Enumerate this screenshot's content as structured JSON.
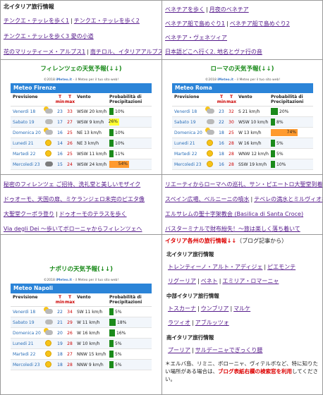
{
  "north_header": "北イタリア旅行情報",
  "north_links": [
    [
      "チンクエ・テッレを歩く1",
      "チンクエ・テッレを歩く2"
    ],
    [
      "チンクエ・テッレを歩く3 愛の小道"
    ],
    [
      "花のマリッティーメ・アルプス1",
      "南チロル、イタリアアルプスへ"
    ]
  ],
  "venice_links": [
    [
      "ベネチアを歩く",
      "月夜のベネチア"
    ],
    [
      "ベネチア船で島めぐり1",
      "ベネチア船で島めぐり2"
    ],
    [
      "ベネチア・ヴェネツィア"
    ],
    [
      "日本語どこへ行く2. 地名とヴァ行の音"
    ]
  ],
  "florence_title": "フィレンツェの天気予報(↓↓)",
  "rome_title": "ローマの天気予報(↓↓)",
  "naples_title": "ナポリの天気予報(↓↓)",
  "widget_credit_pre": "©2018",
  "widget_credit_brand": "iMeteo.it",
  "widget_credit_post": " - il Meteo per il tuo sito web!",
  "widget_cols": {
    "day": "Previsione",
    "tmin": "T min",
    "tmax": "T max",
    "wind": "Vento",
    "prob": "Probabilità di Precipitazioni"
  },
  "colors": {
    "bar_blue": "#2b84d8",
    "prob_green": "#1b8a1b",
    "prob_yellow": "#ffff33",
    "prob_orange": "#ff9a2e",
    "red_text": "#dd0000"
  },
  "widgets": [
    {
      "key": "florence",
      "name": "Meteo Firenze",
      "rows": [
        {
          "day": "Venerdi 18",
          "icon": "cloud-icon",
          "tmin": "23",
          "tmax": "33",
          "wind": "WSW 20 km/h",
          "prob": 10,
          "color": "green"
        },
        {
          "day": "Sabato 19",
          "icon": "cloud-icon",
          "tmin": "17",
          "tmax": "27",
          "wind": "WSW 9 km/h",
          "prob": 26,
          "color": "yellow"
        },
        {
          "day": "Domenica 20",
          "icon": "cloud-icon",
          "tmin": "16",
          "tmax": "25",
          "wind": "NE 13 km/h",
          "prob": 10,
          "color": "green"
        },
        {
          "day": "Lunedi 21",
          "icon": "sun-icon",
          "tmin": "14",
          "tmax": "26",
          "wind": "NE 3 km/h",
          "prob": 10,
          "color": "green"
        },
        {
          "day": "Martedi 22",
          "icon": "sun-icon",
          "tmin": "16",
          "tmax": "25",
          "wind": "WSW 11 km/h",
          "prob": 11,
          "color": "green"
        },
        {
          "day": "Mercoledi 23",
          "icon": "storm-icon",
          "tmin": "15",
          "tmax": "24",
          "wind": "WSW 24 km/h",
          "prob": 54,
          "color": "orange"
        }
      ]
    },
    {
      "key": "rome",
      "name": "Meteo Roma",
      "rows": [
        {
          "day": "Venerdi 18",
          "icon": "cloud-icon",
          "tmin": "23",
          "tmax": "32",
          "wind": "S 21 km/h",
          "prob": 20,
          "color": "green"
        },
        {
          "day": "Sabato 19",
          "icon": "cloud-icon",
          "tmin": "22",
          "tmax": "30",
          "wind": "WSW 10 km/h",
          "prob": 8,
          "color": "green"
        },
        {
          "day": "Domenica 20",
          "icon": "cloud-icon",
          "tmin": "18",
          "tmax": "25",
          "wind": "W 13 km/h",
          "prob": 74,
          "color": "orange"
        },
        {
          "day": "Lunedi 21",
          "icon": "sun-icon",
          "tmin": "16",
          "tmax": "28",
          "wind": "W 16 km/h",
          "prob": 5,
          "color": "green"
        },
        {
          "day": "Martedi 22",
          "icon": "sun-icon",
          "tmin": "18",
          "tmax": "28",
          "wind": "WNW 12 km/h",
          "prob": 5,
          "color": "green"
        },
        {
          "day": "Mercoledi 23",
          "icon": "sun-icon",
          "tmin": "16",
          "tmax": "28",
          "wind": "SSW 19 km/h",
          "prob": 10,
          "color": "green"
        }
      ]
    },
    {
      "key": "naples",
      "name": "Meteo Napoli",
      "rows": [
        {
          "day": "Venerdi 18",
          "icon": "cloud-icon",
          "tmin": "22",
          "tmax": "34",
          "wind": "SW 11 km/h",
          "prob": 5,
          "color": "green"
        },
        {
          "day": "Sabato 19",
          "icon": "cloud-icon",
          "tmin": "21",
          "tmax": "29",
          "wind": "W 11 km/h",
          "prob": 18,
          "color": "green"
        },
        {
          "day": "Domenica 20",
          "icon": "cloud-icon",
          "tmin": "20",
          "tmax": "26",
          "wind": "W 16 km/h",
          "prob": 16,
          "color": "green"
        },
        {
          "day": "Lunedi 21",
          "icon": "sun-icon",
          "tmin": "19",
          "tmax": "28",
          "wind": "W 10 km/h",
          "prob": 5,
          "color": "green"
        },
        {
          "day": "Martedi 22",
          "icon": "sun-icon",
          "tmin": "18",
          "tmax": "27",
          "wind": "NNW 15 km/h",
          "prob": 5,
          "color": "green"
        },
        {
          "day": "Mercoledi 23",
          "icon": "sun-icon",
          "tmin": "18",
          "tmax": "28",
          "wind": "NNW 9 km/h",
          "prob": 5,
          "color": "green"
        }
      ]
    }
  ],
  "florence_links": [
    [
      "秘密のフィレンツェ ご招待、洗礼堂と美しいモザイク"
    ],
    [
      "ドゥオーモ、天国の扉、ミケランジェロ未完のピエタ像"
    ],
    [
      "大聖堂クーポラ登り",
      "ドゥオーモのテラスを歩く"
    ],
    [
      "Via degli Dei ～歩いてボローニャからフィレンツェへ"
    ]
  ],
  "rome_links": [
    [
      "リエーティからローマへの巡礼、サン・ピエートロ大聖堂到着"
    ],
    [
      "スペイン広場、ベルニーニの噴水",
      "テベレの満水とミルヴィオ橋"
    ],
    [
      "エルサレムの聖十字架教会 (Basilica di Santa Croce)"
    ],
    [
      "バスターミナルで財布紛失！～旅は楽しく落ち着いて"
    ]
  ],
  "italy_header": "イタリア各州の旅行情報↓↓",
  "italy_header_suffix": "（ブログ記事から）",
  "north_sub": "北イタリア旅行情報",
  "north_regions": [
    [
      "トレンティーノ・アルト・アディジェ",
      "ピエモンテ"
    ],
    [
      "リグーリア",
      "ベネト",
      "エミリア・ロマーニャ"
    ]
  ],
  "central_sub": "中部イタリア旅行情報",
  "central_regions": [
    [
      "トスカーナ",
      "ウンブリア",
      "マルケ"
    ],
    [
      "ラツィオ",
      "アブルッツォ"
    ]
  ],
  "south_sub": "南イタリア旅行情報",
  "south_regions": [
    [
      "プーリア",
      "サルデーニャでぎっくり腰"
    ]
  ],
  "note_text": "＊エルバ島、リミニ、ボローニャ、ヴィテルボなど、特に知りたい場所がある場合は、",
  "note_red": "ブログ表紙右欄の検索窓を利用",
  "note_end": "してください。"
}
